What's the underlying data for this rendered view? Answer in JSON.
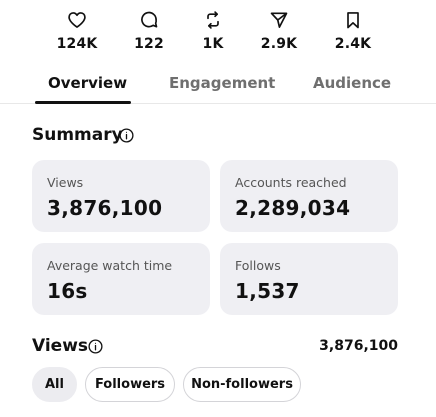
{
  "stats": [
    {
      "icon": "heart-icon",
      "value": "124K"
    },
    {
      "icon": "comment-icon",
      "value": "122"
    },
    {
      "icon": "repost-icon",
      "value": "1K"
    },
    {
      "icon": "share-icon",
      "value": "2.9K"
    },
    {
      "icon": "bookmark-icon",
      "value": "2.4K"
    }
  ],
  "tabs": {
    "active": "Overview",
    "items": [
      "Overview",
      "Engagement",
      "Audience"
    ]
  },
  "summary": {
    "title": "Summary",
    "cards": [
      {
        "label": "Views",
        "value": "3,876,100"
      },
      {
        "label": "Accounts reached",
        "value": "2,289,034"
      },
      {
        "label": "Average watch time",
        "value": "16s"
      },
      {
        "label": "Follows",
        "value": "1,537"
      }
    ]
  },
  "views_section": {
    "title": "Views",
    "total": "3,876,100",
    "filters": [
      "All",
      "Followers",
      "Non-followers"
    ],
    "active_filter": "All"
  },
  "colors": {
    "card_bg": "#efeff3",
    "text": "#111111",
    "muted": "#6f6f6f"
  }
}
